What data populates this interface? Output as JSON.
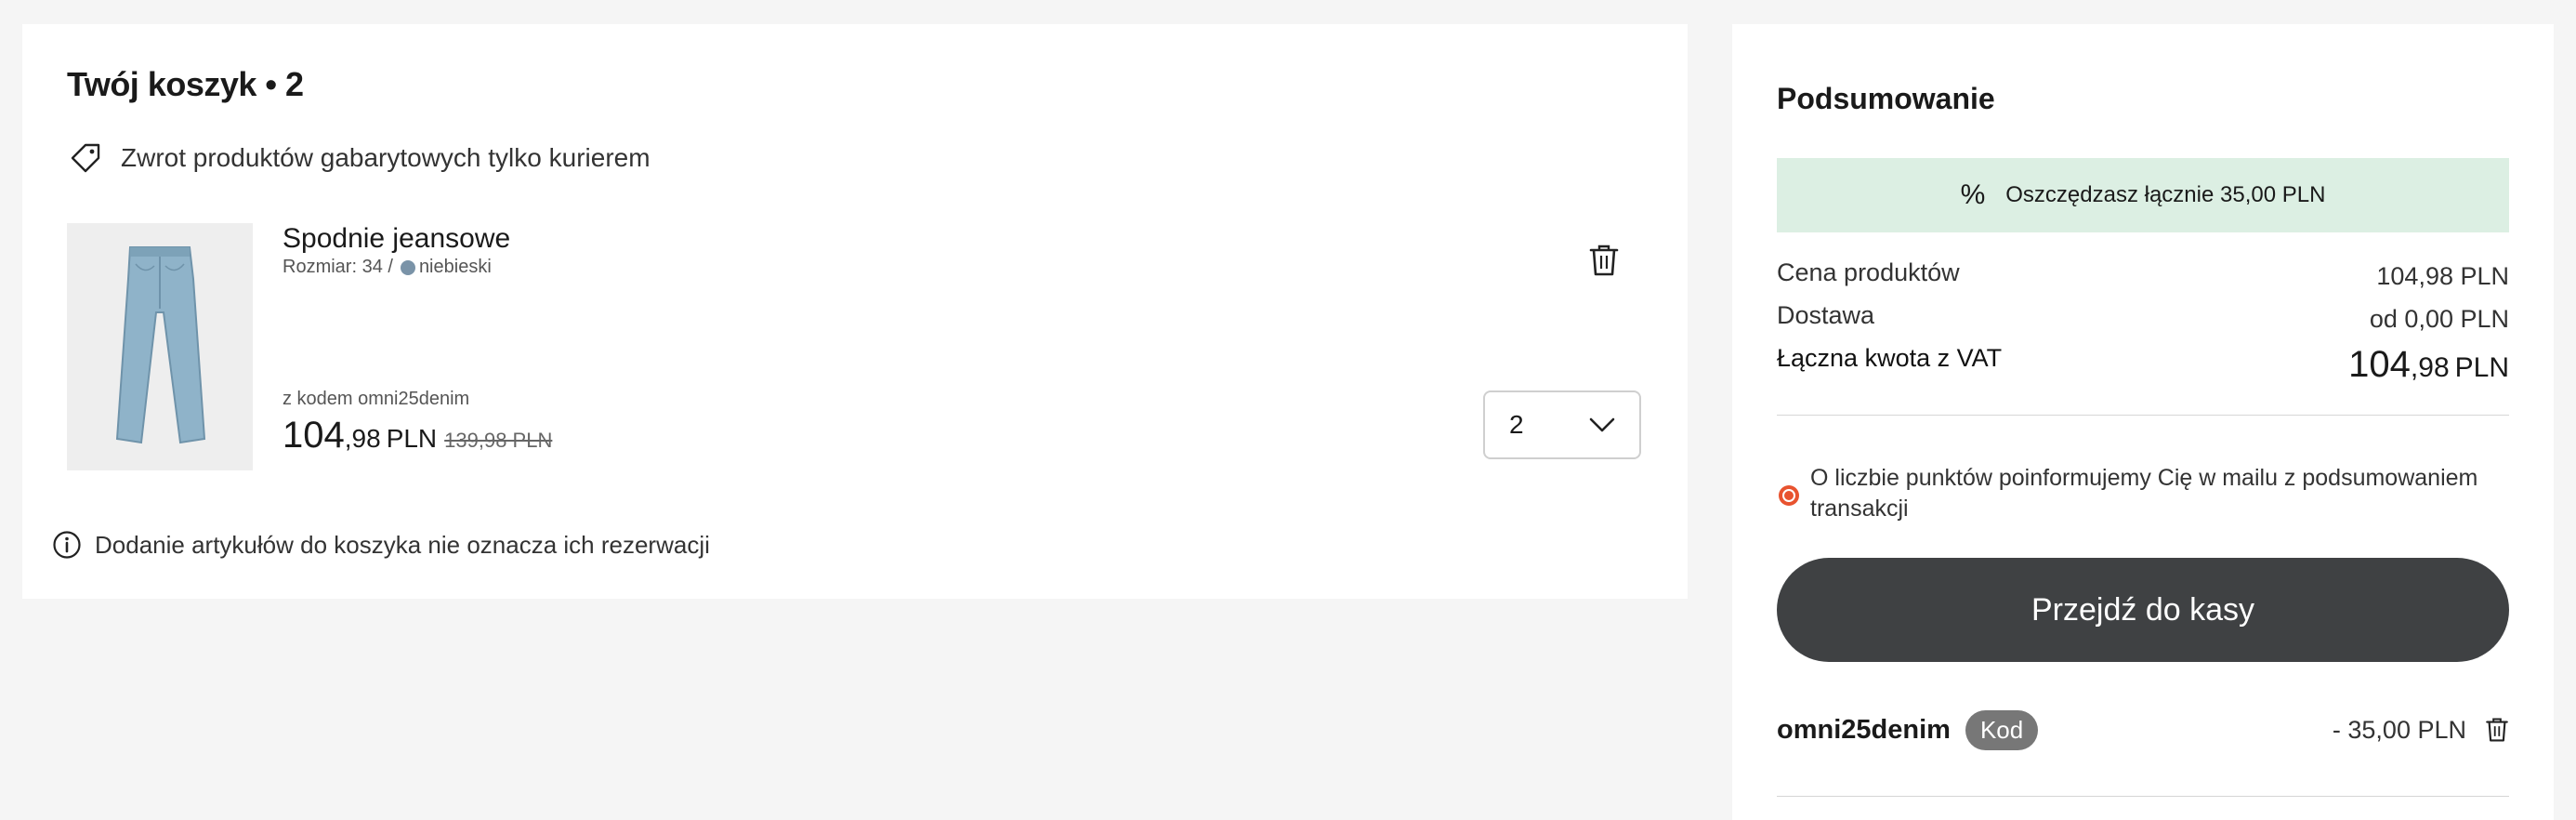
{
  "cart": {
    "title": "Twój koszyk • 2",
    "return_notice": "Zwrot produktów gabarytowych tylko kurierem",
    "item": {
      "name": "Spodnie jeansowe",
      "size_text": "Rozmiar: 34 /",
      "color_name": "niebieski",
      "color_hex": "#7a93a8",
      "code_note": "z kodem omni25denim",
      "price_int": "104",
      "price_dec": ",98",
      "price_currency": "PLN",
      "price_old": "139,98 PLN",
      "quantity": "2"
    },
    "reservation_notice": "Dodanie artykułów do koszyka nie oznacza ich rezerwacji"
  },
  "summary": {
    "title": "Podsumowanie",
    "savings": "Oszczędzasz łącznie 35,00 PLN",
    "products_label": "Cena produktów",
    "products_value": "104,98 PLN",
    "shipping_label": "Dostawa",
    "shipping_value": "od 0,00 PLN",
    "total_label": "Łączna kwota z VAT",
    "total_int": "104",
    "total_dec": ",98",
    "total_currency": "PLN",
    "points_text": "O liczbie punktów poinformujemy Cię w mailu z podsumowaniem transakcji",
    "checkout_label": "Przejdź do kasy",
    "promo_code": "omni25denim",
    "promo_badge": "Kod",
    "promo_amount": "- 35,00 PLN"
  },
  "colors": {
    "savings_bg": "#dcefe3",
    "checkout_bg": "#3f4143",
    "points_icon": "#e8532f"
  }
}
